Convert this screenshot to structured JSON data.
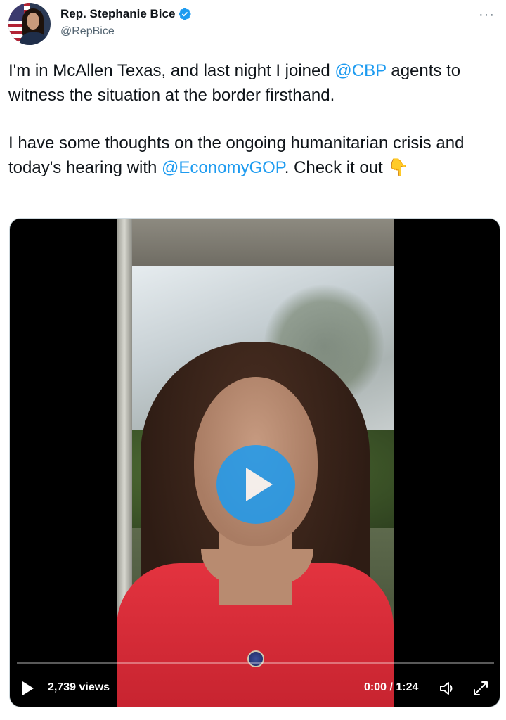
{
  "author": {
    "name": "Rep. Stephanie Bice",
    "handle": "@RepBice",
    "verified": true
  },
  "more_icon": "more-horizontal-icon",
  "tweet": {
    "line1_pre": "I'm in McAllen Texas, and last night I joined ",
    "mention_cbp": "@CBP",
    "line1_post": " agents to witness the situation at the border firsthand.",
    "line2_pre": "I have some thoughts on the ongoing humanitarian crisis and today's hearing with ",
    "mention_economy": "@EconomyGOP",
    "line2_post": ". Check it out ",
    "emoji": "👇"
  },
  "video": {
    "views": "2,739 views",
    "time": "0:00 / 1:24",
    "progress": 0
  },
  "colors": {
    "accent": "#1d9bf0",
    "text": "#0f1419",
    "secondary": "#536471"
  }
}
